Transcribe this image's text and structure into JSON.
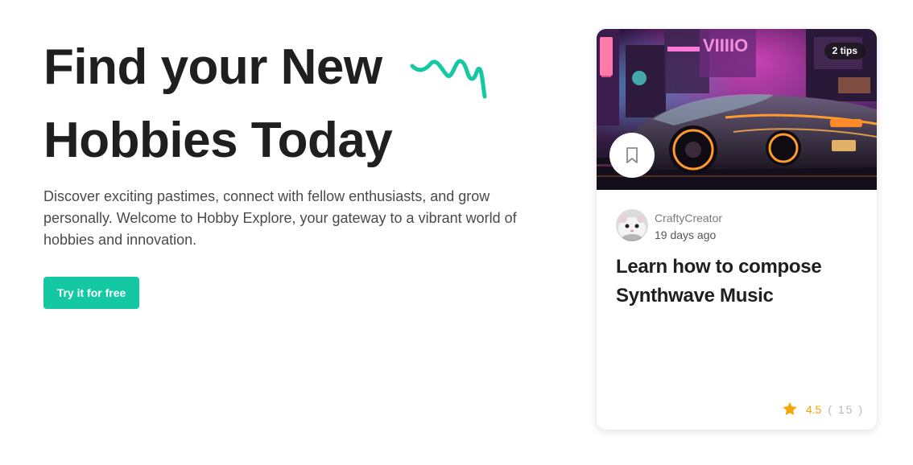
{
  "hero": {
    "title_line1": "Find your New",
    "title_line2": "Hobbies Today",
    "description": "Discover exciting pastimes, connect with fellow enthusiasts, and grow personally. Welcome to Hobby Explore, your gateway to a vibrant world of hobbies and innovation.",
    "cta_label": "Try it for free",
    "accent_color": "#14c8a4"
  },
  "card": {
    "badge": "2 tips",
    "author": "CraftyCreator",
    "posted": "19 days ago",
    "title": "Learn how to compose Synthwave Music",
    "rating": "4.5",
    "rating_count": "( 15 )",
    "rating_color": "#f5a400",
    "icons": {
      "bookmark": "bookmark-icon",
      "star": "star-icon"
    }
  }
}
